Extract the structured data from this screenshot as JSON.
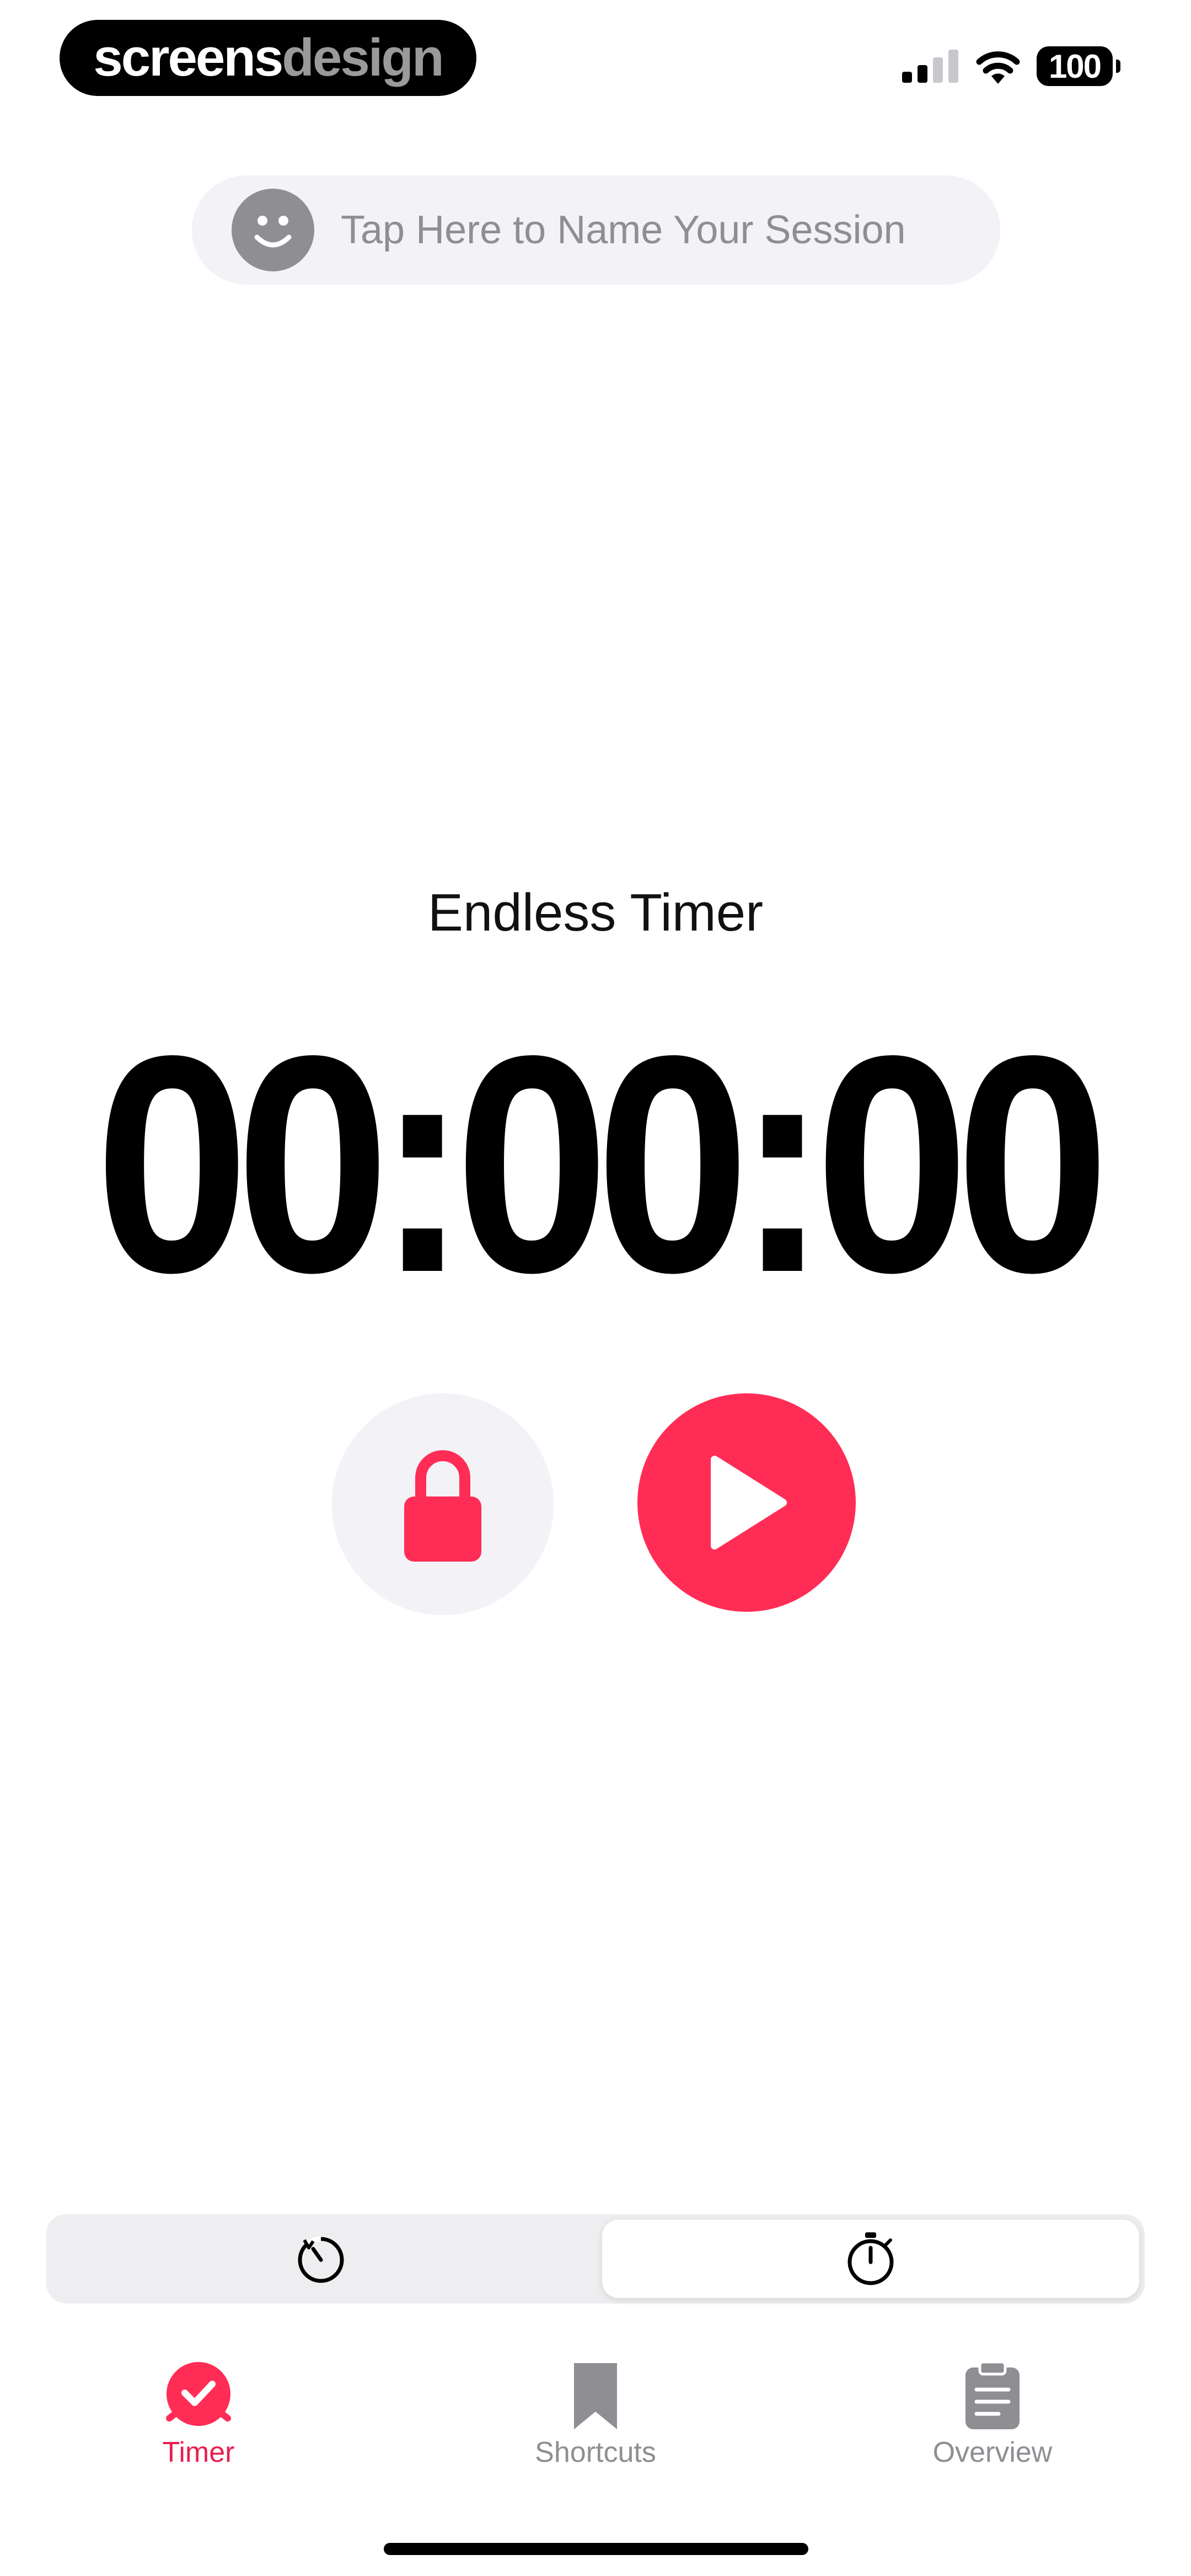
{
  "watermark": {
    "brand_part1": "screens",
    "brand_part2": "design"
  },
  "status_bar": {
    "battery_level": "100",
    "signal_icon": "cellular-signal-icon",
    "wifi_icon": "wifi-icon"
  },
  "session": {
    "icon": "smiley-face-icon",
    "placeholder_label": "Tap Here to Name Your Session"
  },
  "timer": {
    "mode_label": "Endless Timer",
    "display": "00:00:00"
  },
  "controls": {
    "lock_icon": "lock-icon",
    "play_icon": "play-icon",
    "accent_color": "#ff2d55",
    "secondary_background": "#f2f2f7"
  },
  "mode_switch": {
    "segments": [
      {
        "icon": "timer-countdown-icon",
        "selected": false
      },
      {
        "icon": "stopwatch-icon",
        "selected": true
      }
    ]
  },
  "tab_bar": {
    "tabs": [
      {
        "label": "Timer",
        "icon": "timer-check-icon",
        "active": true
      },
      {
        "label": "Shortcuts",
        "icon": "bookmark-icon",
        "active": false
      },
      {
        "label": "Overview",
        "icon": "clipboard-icon",
        "active": false
      }
    ],
    "active_color": "#e91e4e",
    "inactive_color": "#8e8e93"
  }
}
